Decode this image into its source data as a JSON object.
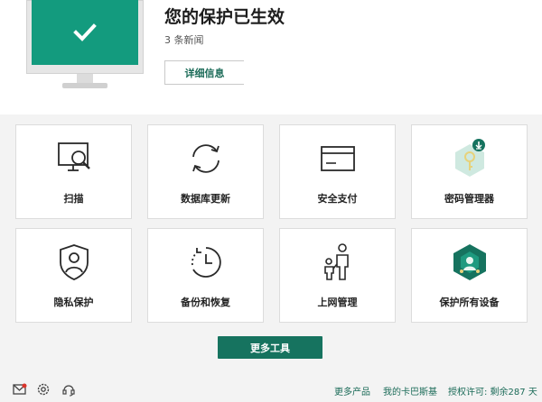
{
  "status": {
    "title": "您的保护已生效",
    "news": "3 条新闻",
    "details_label": "详细信息",
    "color": "#139b7e"
  },
  "tiles": [
    {
      "label": "扫描",
      "icon": "scan-icon"
    },
    {
      "label": "数据库更新",
      "icon": "update-icon"
    },
    {
      "label": "安全支付",
      "icon": "safe-money-icon"
    },
    {
      "label": "密码管理器",
      "icon": "password-manager-icon"
    },
    {
      "label": "隐私保护",
      "icon": "privacy-shield-icon"
    },
    {
      "label": "备份和恢复",
      "icon": "backup-clock-icon"
    },
    {
      "label": "上网管理",
      "icon": "parental-control-icon"
    },
    {
      "label": "保护所有设备",
      "icon": "protect-devices-icon"
    }
  ],
  "more_tools_label": "更多工具",
  "footer": {
    "links": [
      "更多产品",
      "我的卡巴斯基",
      "授权许可: 剩余287 天"
    ],
    "icons": [
      "mail-icon",
      "settings-gear-icon",
      "support-headset-icon"
    ]
  },
  "colors": {
    "accent": "#16735f",
    "teal": "#139b7e"
  }
}
